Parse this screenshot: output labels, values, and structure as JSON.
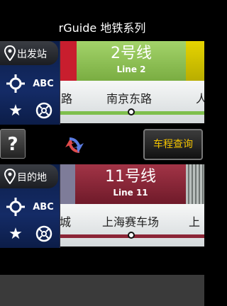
{
  "app": {
    "title": "rGuide 地铁系列"
  },
  "origin": {
    "tab_label": "出发站",
    "abc_label": "ABC",
    "line": {
      "name": "2号线",
      "latin": "Line 2",
      "color": "#8cc051"
    },
    "prev_line_color": "#c81e2e",
    "next_line_color": "#d4c400",
    "stations": {
      "current": "南京东路",
      "left_partial": "路",
      "right_partial": "人"
    }
  },
  "destination": {
    "tab_label": "目的地",
    "abc_label": "ABC",
    "line": {
      "name": "11号线",
      "latin": "Line 11",
      "color": "#8b2536"
    },
    "prev_line_color": "#7e7c99",
    "next_line_color": "#9aa09e",
    "stations": {
      "current": "上海赛车场",
      "left_partial": "城",
      "right_partial": "上"
    }
  },
  "controls": {
    "help_label": "?",
    "query_label": "车程查询"
  }
}
